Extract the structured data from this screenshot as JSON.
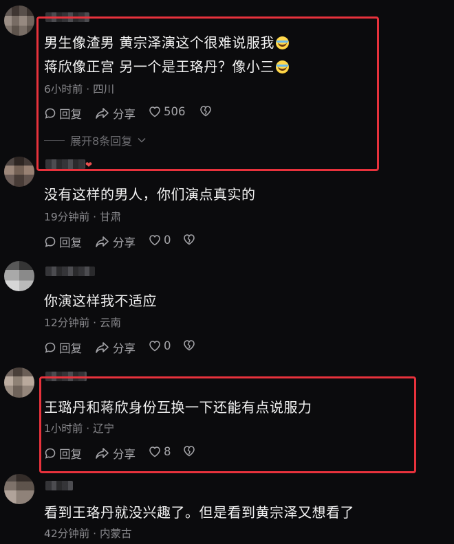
{
  "comments": [
    {
      "lines": [
        "男生像渣男 黄宗泽演这个很难说服我",
        "蒋欣像正宫 另一个是王珞丹？像小三"
      ],
      "meta": "6小时前 · 四川",
      "reply_label": "回复",
      "share_label": "分享",
      "likes": "506",
      "expand_label": "展开8条回复"
    },
    {
      "lines": [
        "没有这样的男人，你们演点真实的"
      ],
      "meta": "19分钟前 · 甘肃",
      "reply_label": "回复",
      "share_label": "分享",
      "likes": "0"
    },
    {
      "lines": [
        "你演这样我不适应"
      ],
      "meta": "12分钟前 · 云南",
      "reply_label": "回复",
      "share_label": "分享",
      "likes": "0"
    },
    {
      "lines": [
        "王璐丹和蒋欣身份互换一下还能有点说服力"
      ],
      "meta": "1小时前 · 辽宁",
      "reply_label": "回复",
      "share_label": "分享",
      "likes": "8"
    },
    {
      "lines": [
        "看到王珞丹就没兴趣了。但是看到黄宗泽又想看了"
      ],
      "meta": "42分钟前 · 内蒙古"
    }
  ],
  "icons": {
    "reply": "reply-bubble-icon",
    "share": "share-arrow-icon",
    "like": "heart-icon",
    "dislike": "broken-heart-icon",
    "emoji": "laugh-cry-emoji-icon",
    "expand": "chevron-down-icon"
  },
  "colors": {
    "background": "#0b0b0d",
    "highlight": "#e8323c",
    "text": "#f1f1f1",
    "meta": "#8a8a8e"
  }
}
